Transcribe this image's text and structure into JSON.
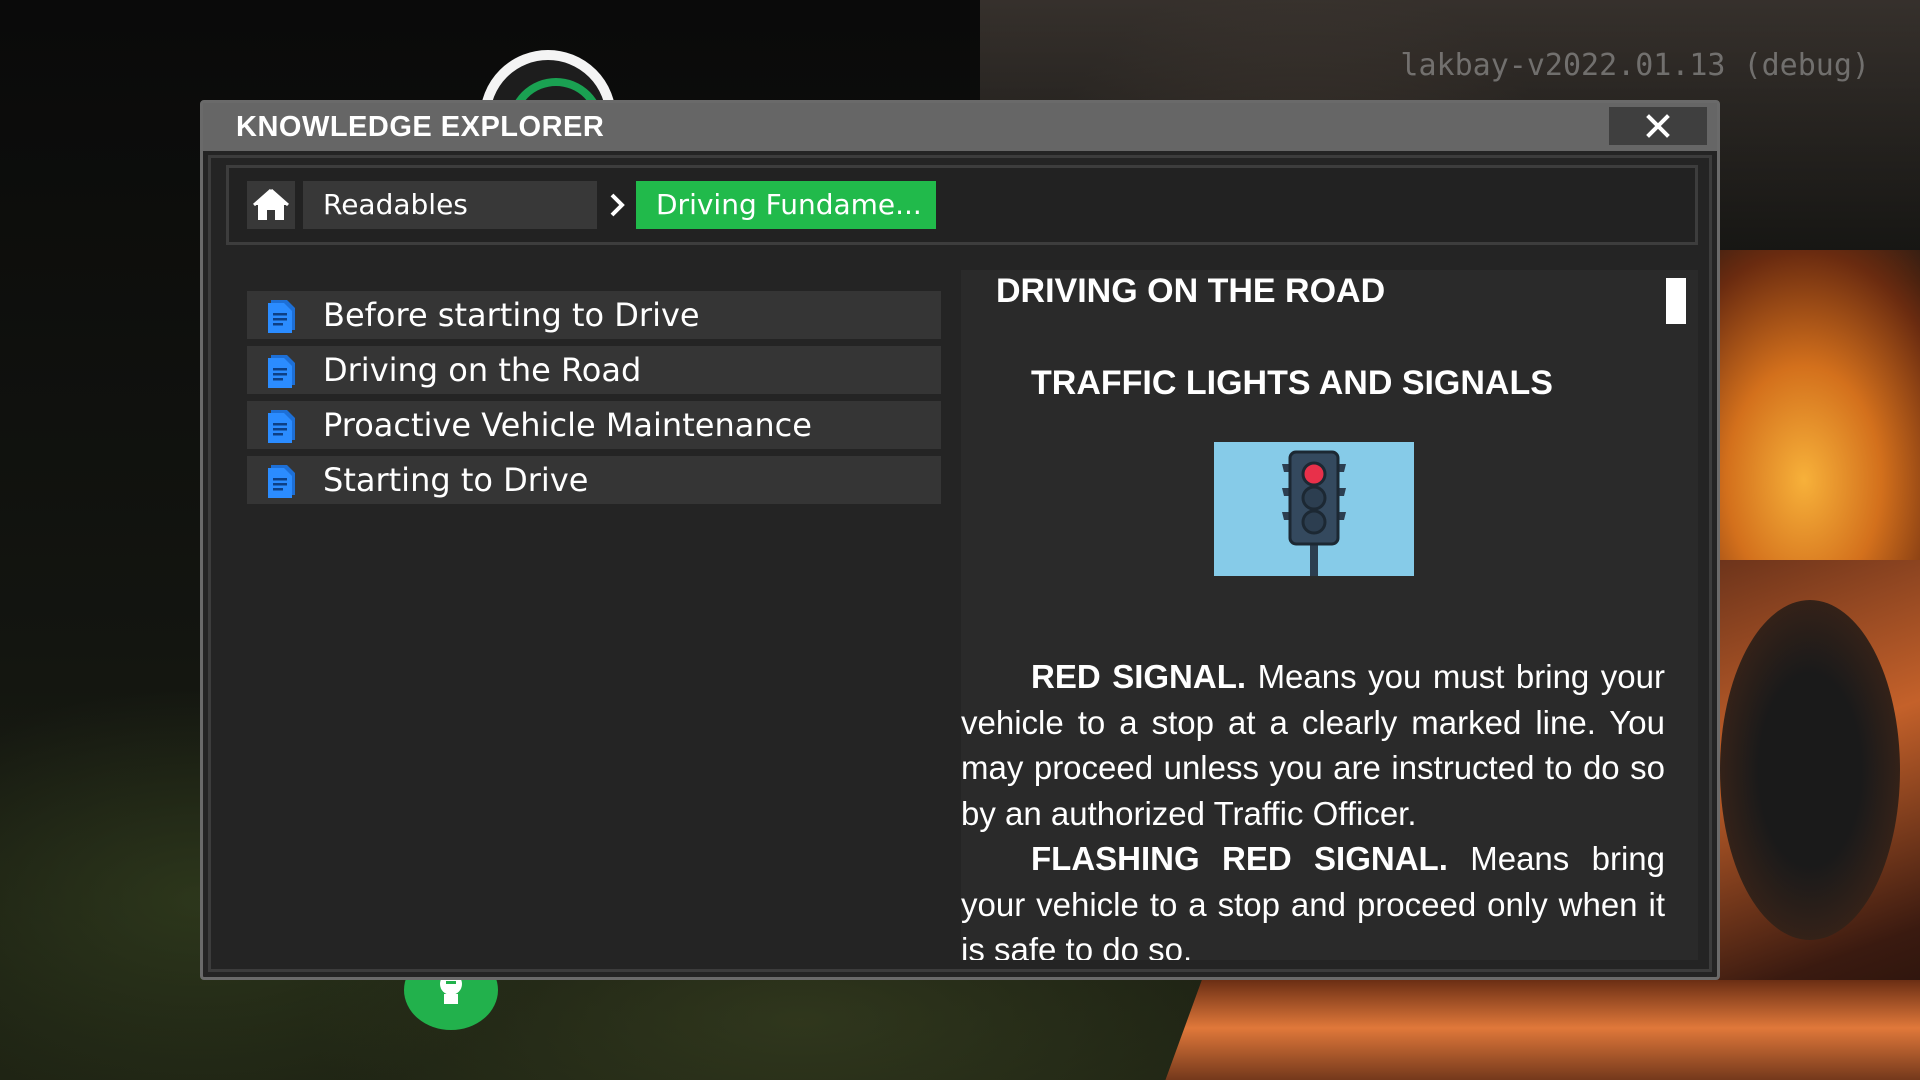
{
  "version_label": "lakbay-v2022.01.13 (debug)",
  "window": {
    "title": "KNOWLEDGE EXPLORER",
    "close_glyph": "✕"
  },
  "breadcrumb": {
    "home_icon": "home-icon",
    "items": [
      {
        "label": "Readables"
      },
      {
        "label": "Driving Fundame..."
      }
    ],
    "separator_icon": "chevron-right-icon",
    "active_color": "#21ba4b"
  },
  "documents": [
    {
      "label": "Before starting to Drive",
      "icon": "document-icon"
    },
    {
      "label": "Driving on the Road",
      "icon": "document-icon"
    },
    {
      "label": "Proactive Vehicle Maintenance",
      "icon": "document-icon"
    },
    {
      "label": "Starting to Drive",
      "icon": "document-icon"
    }
  ],
  "reader": {
    "heading": "DRIVING ON THE ROAD",
    "subheading": "TRAFFIC LIGHTS AND SIGNALS",
    "illustration": "traffic-light-illustration",
    "paragraphs": [
      {
        "lead": "RED SIGNAL.",
        "text": " Means you must bring your vehicle to a stop at a clearly marked line. You may proceed unless you are instructed to do so by an authorized Traffic Officer."
      },
      {
        "lead": "FLASHING RED SIGNAL.",
        "text": " Means bring your vehicle to a stop and proceed only when it is safe to do so."
      }
    ]
  }
}
